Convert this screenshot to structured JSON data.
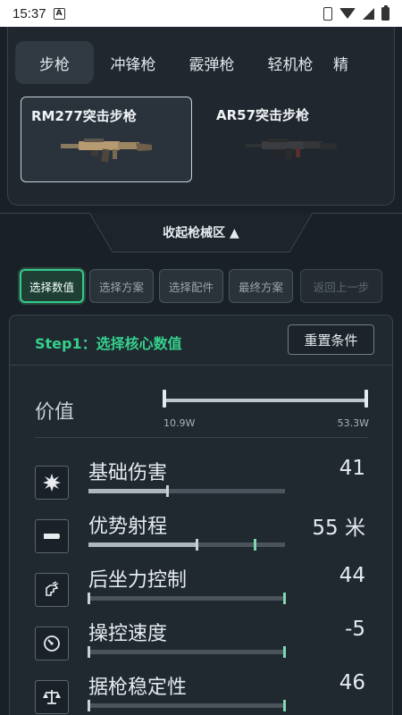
{
  "status_bar": {
    "time": "15:37",
    "a_badge": "A"
  },
  "weapon_tabs": [
    {
      "label": "步枪",
      "active": true
    },
    {
      "label": "冲锋枪",
      "active": false
    },
    {
      "label": "霰弹枪",
      "active": false
    },
    {
      "label": "轻机枪",
      "active": false
    },
    {
      "label": "精",
      "active": false
    }
  ],
  "weapons": [
    {
      "name": "RM277突击步枪",
      "selected": true
    },
    {
      "name": "AR57突击步枪",
      "selected": false
    }
  ],
  "collapse": {
    "label": "收起枪械区 ▲"
  },
  "steps": [
    {
      "label": "选择数值",
      "state": "active"
    },
    {
      "label": "选择方案",
      "state": "normal"
    },
    {
      "label": "选择配件",
      "state": "normal"
    },
    {
      "label": "最终方案",
      "state": "normal"
    },
    {
      "label": "返回上一步",
      "state": "disabled"
    }
  ],
  "panel": {
    "step_title": "Step1：选择核心数值",
    "reset_label": "重置条件",
    "price": {
      "label": "价值",
      "min_label": "10.9W",
      "max_label": "53.3W",
      "low_fraction": 0.0,
      "high_fraction": 1.0
    }
  },
  "stats": [
    {
      "name": "基础伤害",
      "value": "41",
      "icon": "burst-icon",
      "level": 0.4,
      "mark2": null
    },
    {
      "name": "优势射程",
      "value": "55 米",
      "icon": "bullet-icon",
      "level": 0.55,
      "mark2": 0.85
    },
    {
      "name": "后坐力控制",
      "value": "44",
      "icon": "recoil-hand-icon",
      "level": 0.0,
      "mark2": 1.0
    },
    {
      "name": "操控速度",
      "value": "-5",
      "icon": "speedometer-icon",
      "level": 0.0,
      "mark2": 1.0
    },
    {
      "name": "据枪稳定性",
      "value": "46",
      "icon": "balance-scale-icon",
      "level": 0.0,
      "mark2": 1.0
    }
  ],
  "colors": {
    "accent_green": "#35d08c",
    "background": "#1a2027"
  }
}
